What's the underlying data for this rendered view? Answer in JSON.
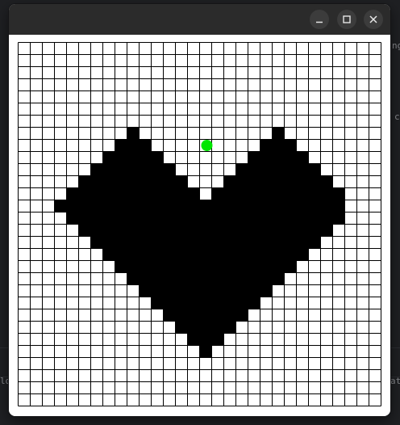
{
  "window": {
    "buttons": [
      {
        "name": "minimize-button",
        "icon": "minimize-icon"
      },
      {
        "name": "maximize-button",
        "icon": "maximize-icon"
      },
      {
        "name": "close-button",
        "icon": "close-icon"
      }
    ]
  },
  "background_text": {
    "top_right": "ng",
    "mid_right": "c",
    "bottom_left": "ld",
    "bottom_right": "at"
  },
  "grid": {
    "columns": 30,
    "rows": 30,
    "cell_color": "#ffffff",
    "filled_color": "#000000",
    "line_color": "#000000",
    "filled_rows": [
      {
        "row": 7,
        "ranges": [
          [
            9,
            9
          ],
          [
            21,
            21
          ]
        ]
      },
      {
        "row": 8,
        "ranges": [
          [
            8,
            10
          ],
          [
            20,
            22
          ]
        ]
      },
      {
        "row": 9,
        "ranges": [
          [
            7,
            11
          ],
          [
            19,
            23
          ]
        ]
      },
      {
        "row": 10,
        "ranges": [
          [
            6,
            12
          ],
          [
            18,
            24
          ]
        ]
      },
      {
        "row": 11,
        "ranges": [
          [
            5,
            13
          ],
          [
            17,
            25
          ]
        ]
      },
      {
        "row": 12,
        "ranges": [
          [
            4,
            14
          ],
          [
            16,
            26
          ]
        ]
      },
      {
        "row": 13,
        "ranges": [
          [
            3,
            26
          ]
        ]
      },
      {
        "row": 14,
        "ranges": [
          [
            4,
            26
          ]
        ]
      },
      {
        "row": 15,
        "ranges": [
          [
            5,
            25
          ]
        ]
      },
      {
        "row": 16,
        "ranges": [
          [
            6,
            24
          ]
        ]
      },
      {
        "row": 17,
        "ranges": [
          [
            7,
            23
          ]
        ]
      },
      {
        "row": 18,
        "ranges": [
          [
            8,
            22
          ]
        ]
      },
      {
        "row": 19,
        "ranges": [
          [
            9,
            21
          ]
        ]
      },
      {
        "row": 20,
        "ranges": [
          [
            10,
            20
          ]
        ]
      },
      {
        "row": 21,
        "ranges": [
          [
            11,
            19
          ]
        ]
      },
      {
        "row": 22,
        "ranges": [
          [
            12,
            18
          ]
        ]
      },
      {
        "row": 23,
        "ranges": [
          [
            13,
            17
          ]
        ]
      },
      {
        "row": 24,
        "ranges": [
          [
            14,
            16
          ]
        ]
      },
      {
        "row": 25,
        "ranges": [
          [
            15,
            15
          ]
        ]
      }
    ],
    "marker": {
      "row": 8,
      "col": 15.6,
      "color": "#00e600",
      "name": "cursor-dot"
    }
  }
}
